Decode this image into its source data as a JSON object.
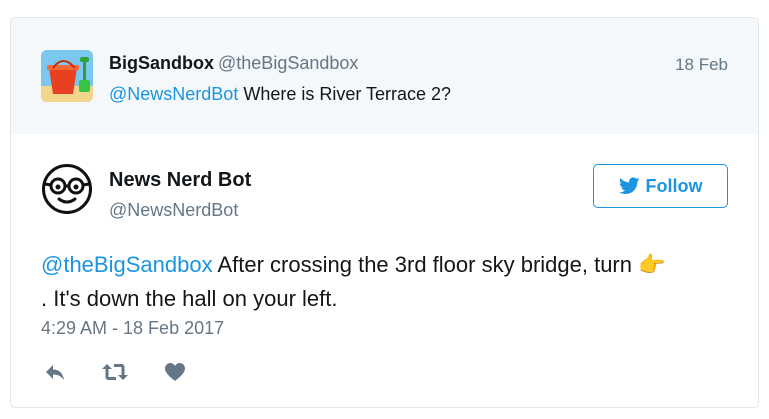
{
  "parent_tweet": {
    "name": "BigSandbox",
    "handle": "@theBigSandbox",
    "date": "18 Feb",
    "mention": "@NewsNerdBot",
    "text": " Where is River Terrace 2?"
  },
  "tweet": {
    "name": "News Nerd Bot",
    "handle": "@NewsNerdBot",
    "follow_label": "Follow",
    "mention": "@theBigSandbox",
    "text_before_emoji": " After crossing the 3rd floor sky bridge, turn ",
    "emoji": "👉",
    "text_after_emoji": ". It's down the hall on your left.",
    "timestamp": "4:29 AM - 18 Feb 2017"
  },
  "icons": {
    "reply": "reply-icon",
    "retweet": "retweet-icon",
    "like": "heart-icon",
    "follow": "twitter-bird-icon"
  },
  "colors": {
    "link": "#1b95e0",
    "muted": "#657786",
    "parent_bg": "#f5f8fa",
    "border": "#e1e8ed"
  }
}
